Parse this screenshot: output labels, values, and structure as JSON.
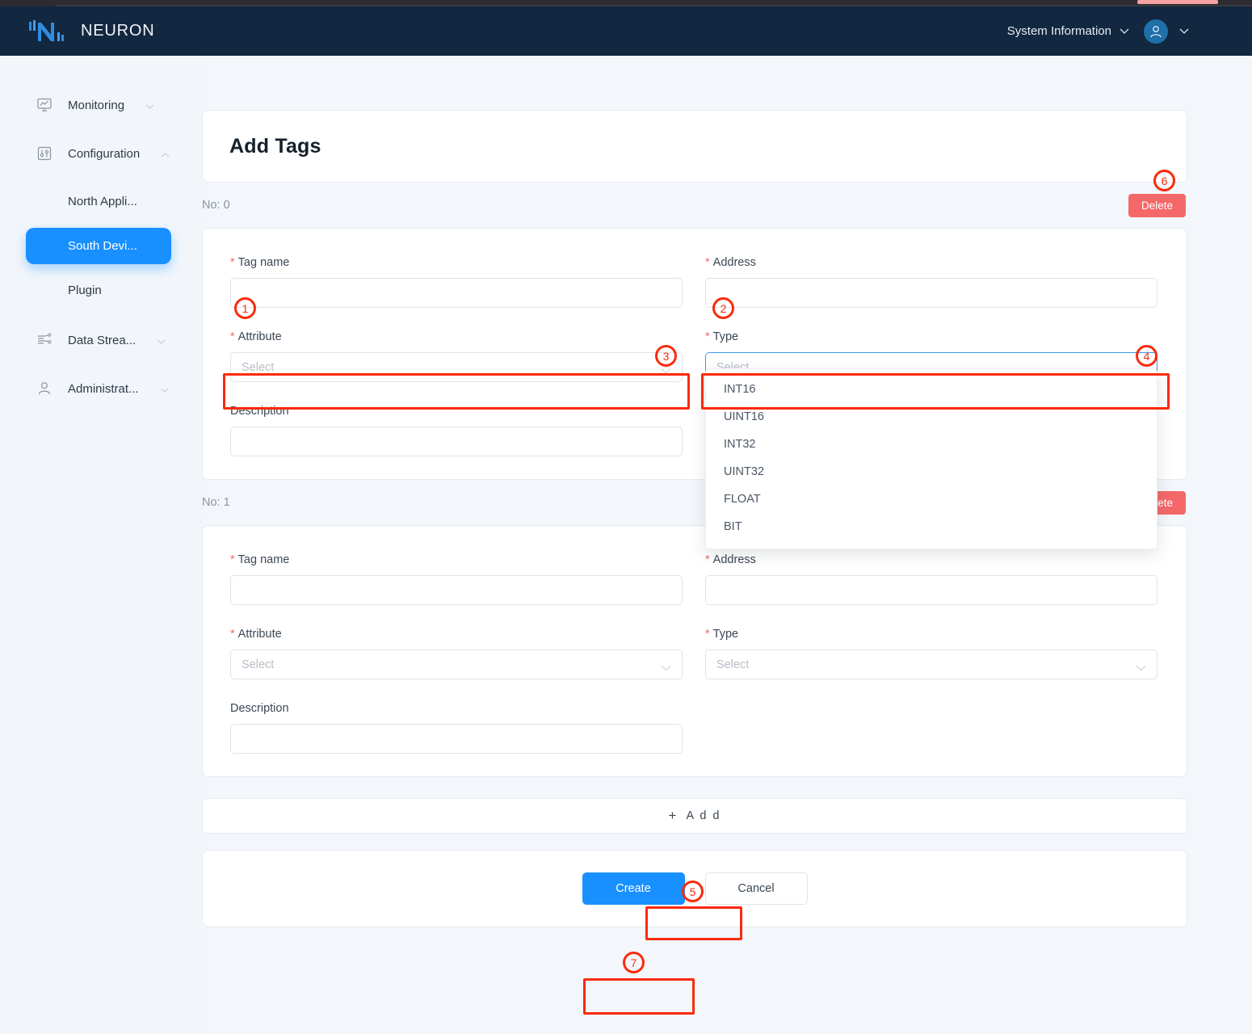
{
  "app": {
    "brand": "NEURON",
    "accent_blue": "#1890ff",
    "nav_bg": "#122740",
    "page_bg": "#f3f7fb",
    "danger_red": "#f5686a",
    "annotation_red": "#fa2a0c"
  },
  "topnav": {
    "system_information_label": "System Information",
    "system_information_icon": "chevron-down-icon",
    "avatar_icon": "user-avatar-icon",
    "avatar_caret_icon": "chevron-down-icon"
  },
  "sidebar": {
    "items": [
      {
        "label": "Monitoring",
        "icon": "monitor-chart-icon",
        "caret": "chevron-down-icon",
        "expanded": false
      },
      {
        "label": "Configuration",
        "icon": "sliders-icon",
        "caret": "chevron-up-icon",
        "expanded": true
      },
      {
        "label": "Data Strea...",
        "icon": "data-stream-icon",
        "caret": "chevron-down-icon",
        "expanded": false
      },
      {
        "label": "Administrat...",
        "icon": "user-icon",
        "caret": "chevron-down-icon",
        "expanded": false
      }
    ],
    "sub_items": [
      {
        "label": "North Appli...",
        "active": false
      },
      {
        "label": "South Devi...",
        "active": true
      },
      {
        "label": "Plugin",
        "active": false
      }
    ]
  },
  "page": {
    "title": "Add Tags"
  },
  "labels": {
    "tag_name": "Tag name",
    "address": "Address",
    "attribute": "Attribute",
    "type": "Type",
    "description": "Description",
    "required_mark": "*",
    "select_placeholder": "Select",
    "delete": "Delete",
    "add": "A d d",
    "add_plus": "+",
    "create": "Create",
    "cancel": "Cancel"
  },
  "tag_rows": [
    {
      "no_label": "No: 0",
      "tag_name_value": "",
      "address_value": "",
      "attribute_value": "",
      "type_value": "",
      "description_value": "",
      "type_dropdown_open": true
    },
    {
      "no_label": "No: 1",
      "tag_name_value": "",
      "address_value": "",
      "attribute_value": "",
      "type_value": "",
      "description_value": "",
      "type_dropdown_open": false
    }
  ],
  "type_options": [
    "INT16",
    "UINT16",
    "INT32",
    "UINT32",
    "FLOAT",
    "BIT"
  ],
  "annotations": [
    {
      "number": "1",
      "target": "tag-name-input-row0"
    },
    {
      "number": "2",
      "target": "address-input-row0"
    },
    {
      "number": "3",
      "target": "attribute-select-row0"
    },
    {
      "number": "4",
      "target": "type-select-row0"
    },
    {
      "number": "5",
      "target": "add-row-button"
    },
    {
      "number": "6",
      "target": "delete-button-row0"
    },
    {
      "number": "7",
      "target": "create-button"
    }
  ]
}
